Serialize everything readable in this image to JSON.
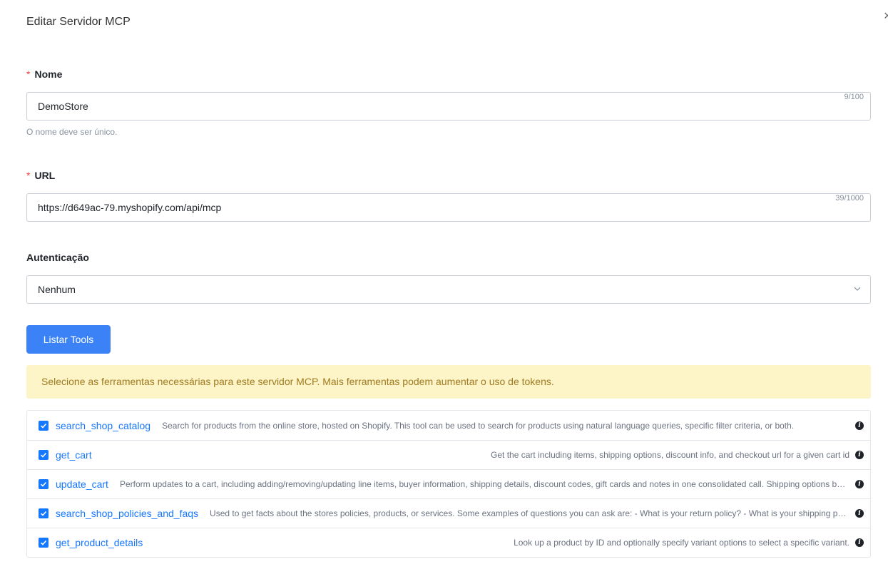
{
  "dialog": {
    "title": "Editar Servidor MCP",
    "close_glyph": "×"
  },
  "form": {
    "required_mark": "*",
    "name": {
      "label": "Nome",
      "value": "DemoStore",
      "count": "9/100",
      "hint": "O nome deve ser único."
    },
    "url": {
      "label": "URL",
      "value": "https://d649ac-79.myshopify.com/api/mcp",
      "count": "39/1000"
    },
    "auth": {
      "label": "Autenticação",
      "selected": "Nenhum"
    },
    "list_tools_label": "Listar Tools",
    "alert": "Selecione as ferramentas necessárias para este servidor MCP. Mais ferramentas podem aumentar o uso de tokens."
  },
  "tools": [
    {
      "name": "search_shop_catalog",
      "checked": true,
      "align": "left",
      "description": "Search for products from the online store, hosted on Shopify. This tool can be used to search for products using natural language queries, specific filter criteria, or both."
    },
    {
      "name": "get_cart",
      "checked": true,
      "align": "right",
      "description": "Get the cart including items, shipping options, discount info, and checkout url for a given cart id"
    },
    {
      "name": "update_cart",
      "checked": true,
      "align": "left",
      "description": "Perform updates to a cart, including adding/removing/updating line items, buyer information, shipping details, discount codes, gift cards and notes in one consolidated call. Shipping options become available after adding items and delivery address."
    },
    {
      "name": "search_shop_policies_and_faqs",
      "checked": true,
      "align": "left",
      "description": "Used to get facts about the stores policies, products, or services. Some examples of questions you can ask are: - What is your return policy? - What is your shipping policy?"
    },
    {
      "name": "get_product_details",
      "checked": true,
      "align": "right",
      "description": "Look up a product by ID and optionally specify variant options to select a specific variant."
    }
  ],
  "colors": {
    "primary": "#3b82f6",
    "link": "#1677ff",
    "required": "#f53f3f",
    "alert_bg": "#fdf4c7",
    "alert_text": "#a07a1f"
  }
}
